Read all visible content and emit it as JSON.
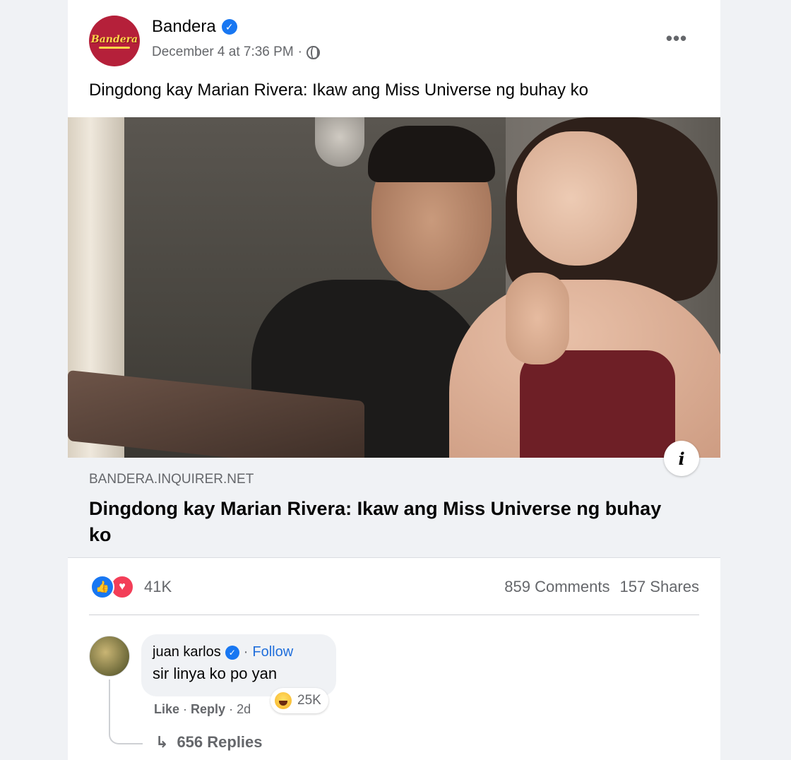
{
  "post": {
    "page_name": "Bandera",
    "logo_text": "Bandera",
    "timestamp": "December 4 at 7:36 PM",
    "meta_separator": "·",
    "more_label": "•••",
    "text": "Dingdong kay Marian Rivera: Ikaw ang Miss Universe ng buhay ko",
    "info_label": "i"
  },
  "link": {
    "domain": "BANDERA.INQUIRER.NET",
    "title": "Dingdong kay Marian Rivera: Ikaw ang Miss Universe ng buhay ko"
  },
  "engagement": {
    "reaction_count": "41K",
    "comments": "859 Comments",
    "shares": "157 Shares"
  },
  "comment": {
    "author": "juan karlos",
    "separator": "·",
    "follow_label": "Follow",
    "text": "sir linya ko po yan",
    "like_label": "Like",
    "reply_label": "Reply",
    "age": "2d",
    "reaction_count": "25K",
    "replies_label": "656 Replies"
  },
  "colors": {
    "accent": "#1877f2",
    "love": "#f33e58",
    "follow": "#216fdb",
    "logo_bg": "#b5203a"
  }
}
